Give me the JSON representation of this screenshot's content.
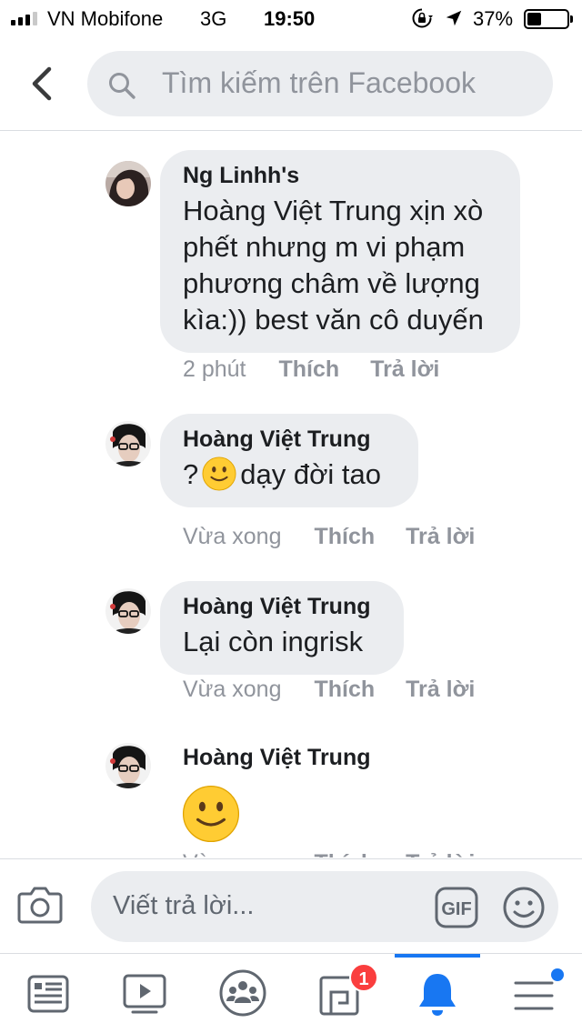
{
  "status_bar": {
    "carrier": "VN Mobifone",
    "network": "3G",
    "time": "19:50",
    "battery_percent": "37%",
    "signal_bars": 3,
    "battery_level": 0.37
  },
  "header": {
    "back_icon": "chevron-left-icon",
    "search_placeholder": "Tìm kiếm trên Facebook"
  },
  "comments": [
    {
      "author": "Ng Linhh's",
      "text": "Hoàng Việt Trung xịn xò\nphết nhưng m vi phạm\nphương châm về lượng\nkìa:)) best văn cô duyến",
      "time": "2 phút",
      "like": "Thích",
      "reply": "Trả lời"
    },
    {
      "author": "Hoàng Việt Trung",
      "text_before": "?",
      "text_after": "dạy đời tao",
      "time": "Vừa xong",
      "like": "Thích",
      "reply": "Trả lời"
    },
    {
      "author": "Hoàng Việt Trung",
      "text": "Lại còn ingrisk",
      "time": "Vừa xong",
      "like": "Thích",
      "reply": "Trả lời"
    },
    {
      "author": "Hoàng Việt Trung",
      "emoji": "slightly-smiling-face",
      "time": "Vừa xong",
      "like": "Thích",
      "reply": "Trả lời"
    }
  ],
  "composer": {
    "placeholder": "Viết trả lời...",
    "gif_label": "GIF"
  },
  "tabbar": {
    "notifications_badge": "1",
    "active_tab": "notifications",
    "tabs": [
      "news-feed",
      "watch",
      "groups",
      "pages",
      "notifications",
      "menu"
    ]
  },
  "colors": {
    "accent": "#1877f2",
    "bubble": "#ebedf0",
    "meta_text": "#90949c",
    "badge": "#fa3e3e"
  }
}
